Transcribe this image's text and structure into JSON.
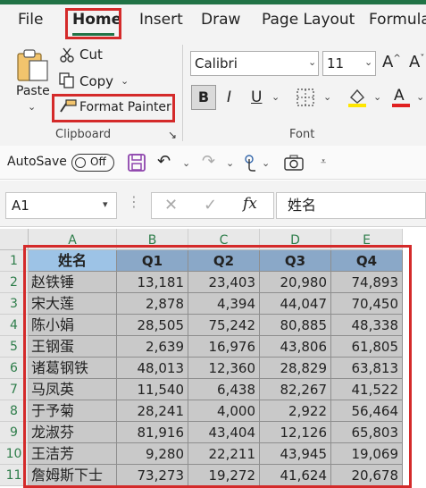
{
  "ribbon_tabs": [
    "File",
    "Home",
    "Insert",
    "Draw",
    "Page Layout",
    "Formulas"
  ],
  "clipboard": {
    "paste_label": "Paste",
    "cut_label": "Cut",
    "copy_label": "Copy",
    "format_painter_label": "Format Painter",
    "group_label": "Clipboard"
  },
  "font": {
    "name": "Calibri",
    "size": "11",
    "group_label": "Font",
    "bold": "B",
    "italic": "I",
    "underline": "U"
  },
  "qat": {
    "autosave_label": "AutoSave",
    "toggle_state": "Off"
  },
  "formula_bar": {
    "name_box": "A1",
    "fx": "fx",
    "content": "姓名"
  },
  "columns": [
    "A",
    "B",
    "C",
    "D",
    "E"
  ],
  "rows": [
    "1",
    "2",
    "3",
    "4",
    "5",
    "6",
    "7",
    "8",
    "9",
    "10",
    "11"
  ],
  "table": {
    "headers": [
      "姓名",
      "Q1",
      "Q2",
      "Q3",
      "Q4"
    ],
    "data": [
      [
        "赵铁锤",
        "13,181",
        "23,403",
        "20,980",
        "74,893"
      ],
      [
        "宋大莲",
        "2,878",
        "4,394",
        "44,047",
        "70,450"
      ],
      [
        "陈小娟",
        "28,505",
        "75,242",
        "80,885",
        "48,338"
      ],
      [
        "王钢蛋",
        "2,639",
        "16,976",
        "43,806",
        "61,805"
      ],
      [
        "诸葛钢铁",
        "48,013",
        "12,360",
        "28,829",
        "63,813"
      ],
      [
        "马凤英",
        "11,540",
        "6,438",
        "82,267",
        "41,522"
      ],
      [
        "于予菊",
        "28,241",
        "4,000",
        "2,922",
        "56,464"
      ],
      [
        "龙淑芬",
        "81,916",
        "43,404",
        "12,126",
        "65,803"
      ],
      [
        "王洁芳",
        "9,280",
        "22,211",
        "43,945",
        "19,069"
      ],
      [
        "詹姆斯下士",
        "73,273",
        "19,272",
        "41,624",
        "20,678"
      ]
    ]
  },
  "colors": {
    "accent": "#217346",
    "highlight_box": "#d42a2a",
    "header_fill": "#8aa8c8",
    "name_header_fill": "#9dc3e6",
    "cell_fill": "#c9c9c9"
  }
}
